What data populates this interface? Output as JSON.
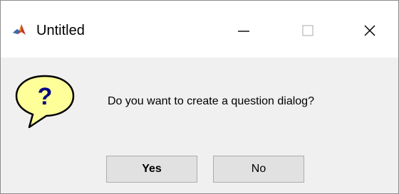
{
  "window": {
    "title": "Untitled",
    "app_icon": "matlab-logo-icon",
    "controls": {
      "minimize": "minimize-icon",
      "maximize": "maximize-icon",
      "close": "close-icon"
    }
  },
  "dialog": {
    "icon": "question-icon",
    "icon_glyph": "?",
    "message": "Do you want to create a question dialog?",
    "buttons": {
      "yes": "Yes",
      "no": "No"
    }
  },
  "colors": {
    "dialog_background": "#f0f0f0",
    "titlebar_background": "#ffffff",
    "icon_bubble_fill": "#ffff99",
    "icon_glyph_color": "#000080",
    "button_face": "#e1e1e1",
    "button_border": "#adadad"
  }
}
